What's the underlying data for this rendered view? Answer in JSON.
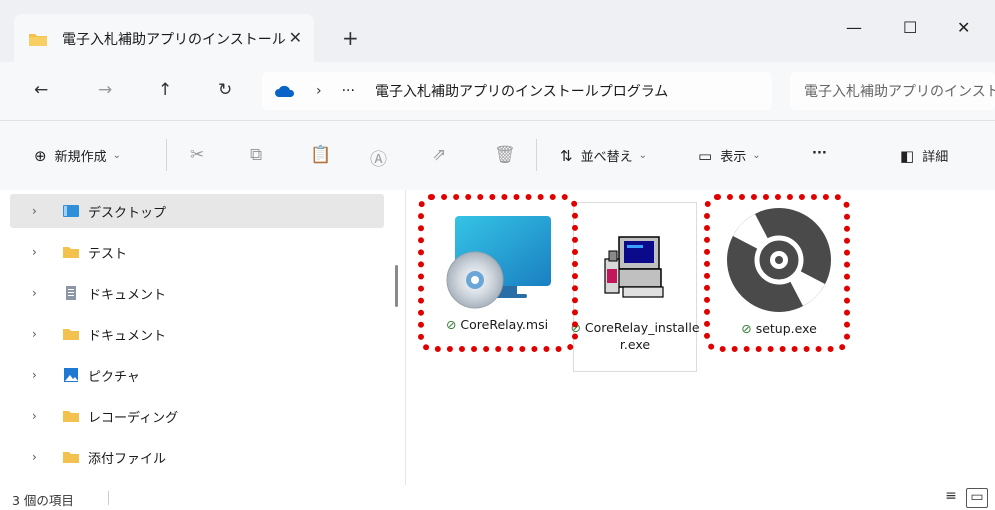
{
  "window": {
    "tab_title": "電子入札補助アプリのインストール",
    "tab_close": "✕",
    "new_tab": "+",
    "minimize": "—",
    "maximize": "☐",
    "close": "✕"
  },
  "nav": {
    "back": "←",
    "forward": "→",
    "up": "↑",
    "refresh": "↻",
    "chevron": "›",
    "ellipsis": "···",
    "address": "電子入札補助アプリのインストールプログラム",
    "search_placeholder": "電子入札補助アプリのインストールプログラムの検索"
  },
  "toolbar": {
    "new_label": "新規作成",
    "new_icon": "⊕",
    "sort_label": "並べ替え",
    "sort_icon": "⇅",
    "view_label": "表示",
    "view_icon": "▭",
    "more": "···",
    "details_label": "詳細",
    "details_icon": "◧",
    "caret": "⌄",
    "cut_icon": "✂",
    "copy_icon": "⧉",
    "paste_icon": "📋",
    "rename_icon": "Ⓐ",
    "share_icon": "⇗",
    "delete_icon": "🗑"
  },
  "sidebar": {
    "items": [
      {
        "label": "デスクトップ",
        "icon": "desktop-icon",
        "selected": true
      },
      {
        "label": "テスト",
        "icon": "folder-icon"
      },
      {
        "label": "ドキュメント",
        "icon": "document-icon"
      },
      {
        "label": "ドキュメント",
        "icon": "folder-icon"
      },
      {
        "label": "ピクチャ",
        "icon": "pictures-icon"
      },
      {
        "label": "レコーディング",
        "icon": "folder-icon"
      },
      {
        "label": "添付ファイル",
        "icon": "folder-icon"
      }
    ],
    "chevron": "›"
  },
  "files": [
    {
      "name": "CoreRelay.msi",
      "icon": "msi-installer-icon",
      "status": "synced"
    },
    {
      "name": "CoreRelay_installer.exe",
      "icon": "legacy-installer-icon",
      "status": "synced"
    },
    {
      "name": "setup.exe",
      "icon": "disc-setup-icon",
      "status": "synced"
    }
  ],
  "status": {
    "item_count": "3 個の項目",
    "check": "⊘"
  },
  "colors": {
    "highlight": "#e00000",
    "folder": "#f2c14e",
    "accent": "#0067c0"
  }
}
